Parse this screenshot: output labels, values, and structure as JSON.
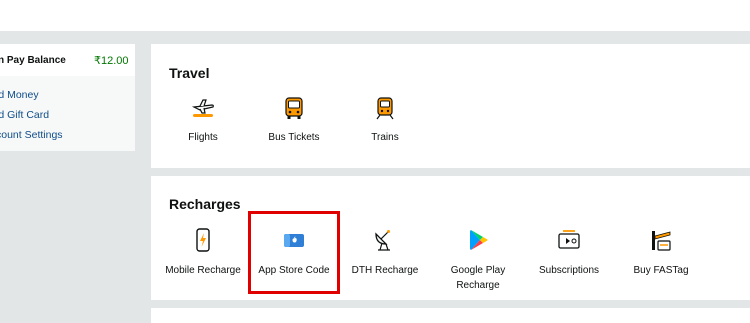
{
  "balance_card": {
    "label": "n Pay Balance",
    "amount": "₹12.00",
    "links": [
      "ld Money",
      "ld Gift Card",
      "count Settings"
    ]
  },
  "travel": {
    "title": "Travel",
    "items": [
      {
        "label": "Flights",
        "icon": "airplane-icon"
      },
      {
        "label": "Bus Tickets",
        "icon": "bus-icon"
      },
      {
        "label": "Trains",
        "icon": "train-icon"
      }
    ]
  },
  "recharges": {
    "title": "Recharges",
    "items": [
      {
        "label": "Mobile Recharge",
        "icon": "mobile-recharge-icon"
      },
      {
        "label": "App Store Code",
        "icon": "app-store-card-icon"
      },
      {
        "label": "DTH Recharge",
        "icon": "satellite-dish-icon"
      },
      {
        "label": "Google Play Recharge",
        "icon": "google-play-icon"
      },
      {
        "label": "Subscriptions",
        "icon": "subscriptions-icon"
      },
      {
        "label": "Buy FASTag",
        "icon": "fastag-toll-icon"
      }
    ]
  },
  "colors": {
    "accent_orange": "#ff9900",
    "link_blue": "#0f4d8a",
    "balance_green": "#007600",
    "highlight_red": "#e00000",
    "background": "#e3e6e6"
  }
}
